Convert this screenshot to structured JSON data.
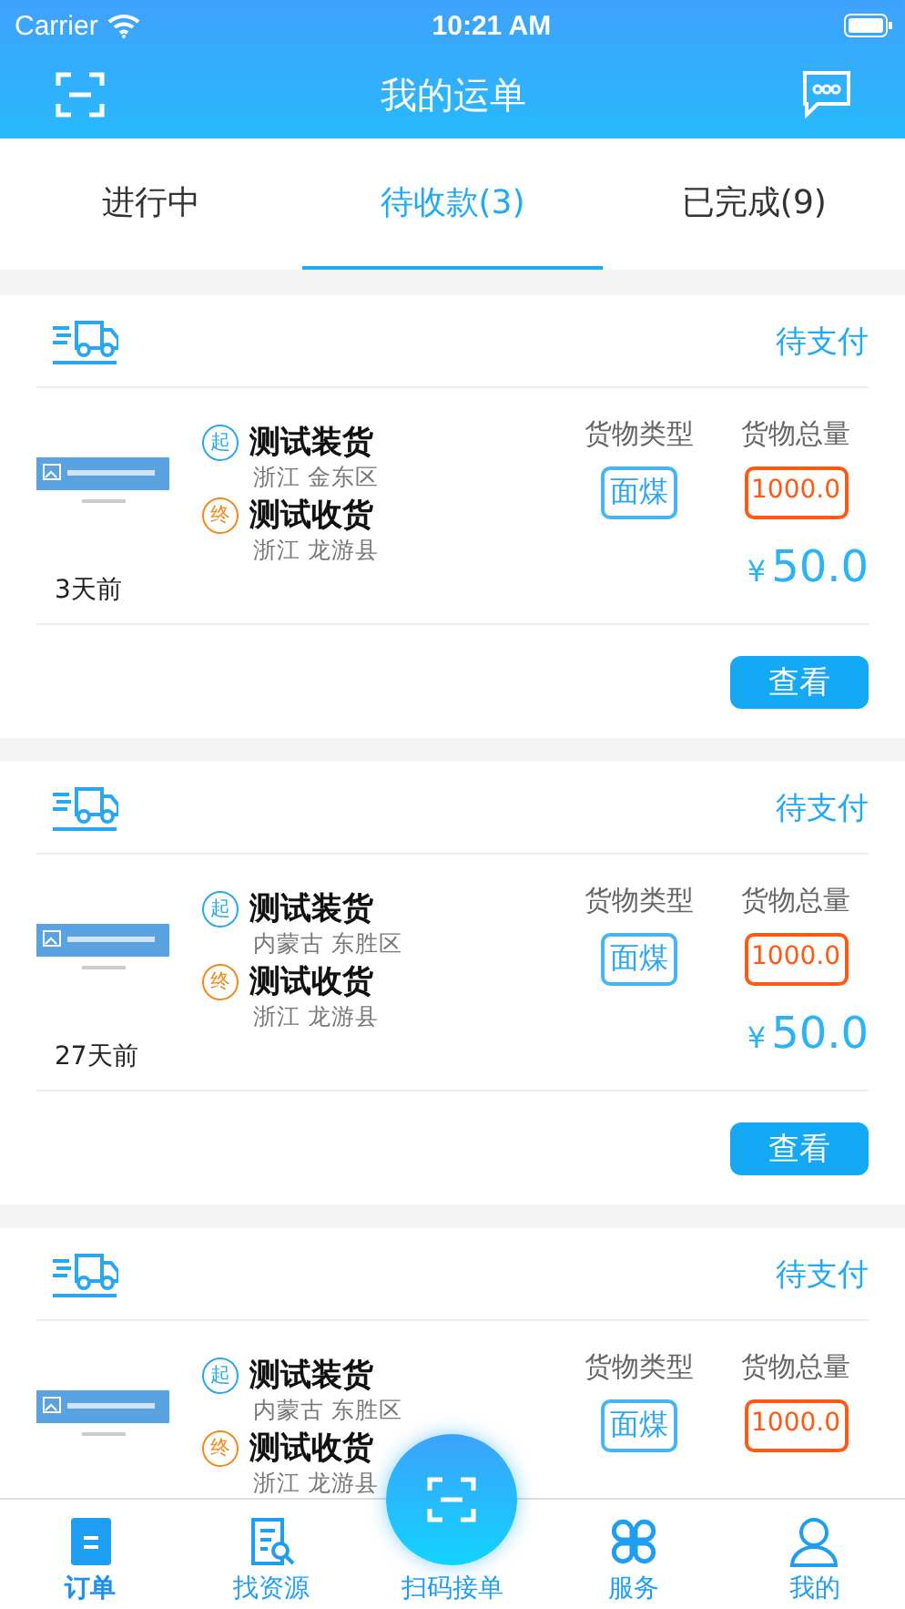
{
  "status_bar": {
    "carrier": "Carrier",
    "time": "10:21 AM"
  },
  "nav": {
    "title": "我的运单"
  },
  "tabs": [
    {
      "label": "进行中",
      "selected": false
    },
    {
      "label": "待收款(3)",
      "selected": true
    },
    {
      "label": "已完成(9)",
      "selected": false
    }
  ],
  "orders": [
    {
      "status": "待支付",
      "from_name": "测试装货",
      "from_place": "浙江 金东区",
      "from_mark": "起",
      "to_name": "测试收货",
      "to_place": "浙江 龙游县",
      "to_mark": "终",
      "type_label": "货物类型",
      "cargo_type": "面煤",
      "amount_label": "货物总量",
      "amount": "1000.0",
      "currency": "¥",
      "price": "50.0",
      "time": "3天前",
      "button": "查看"
    },
    {
      "status": "待支付",
      "from_name": "测试装货",
      "from_place": "内蒙古 东胜区",
      "from_mark": "起",
      "to_name": "测试收货",
      "to_place": "浙江 龙游县",
      "to_mark": "终",
      "type_label": "货物类型",
      "cargo_type": "面煤",
      "amount_label": "货物总量",
      "amount": "1000.0",
      "currency": "¥",
      "price": "50.0",
      "time": "27天前",
      "button": "查看"
    },
    {
      "status": "待支付",
      "from_name": "测试装货",
      "from_place": "内蒙古 东胜区",
      "from_mark": "起",
      "to_name": "测试收货",
      "to_place": "浙江 龙游县",
      "to_mark": "终",
      "type_label": "货物类型",
      "cargo_type": "面煤",
      "amount_label": "货物总量",
      "amount": "1000.0"
    }
  ],
  "tab_bar": [
    {
      "kind": "order",
      "label": "订单",
      "selected": true
    },
    {
      "kind": "search",
      "label": "找资源",
      "selected": false
    },
    {
      "kind": "scan",
      "label": "扫码接单",
      "selected": false
    },
    {
      "kind": "service",
      "label": "服务",
      "selected": false
    },
    {
      "kind": "me",
      "label": "我的",
      "selected": false
    }
  ]
}
